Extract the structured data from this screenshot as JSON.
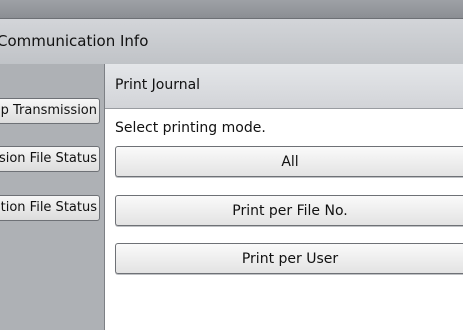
{
  "screen": {
    "title": "Communication Info",
    "left_buttons": [
      {
        "label": "Stop Transmission"
      },
      {
        "label": "Transmission File Status"
      },
      {
        "label": "Reception File Status"
      }
    ]
  },
  "dialog": {
    "title": "Print Journal",
    "prompt": "Select printing mode.",
    "options": [
      {
        "label": "All"
      },
      {
        "label": "Print per File No."
      },
      {
        "label": "Print per User"
      }
    ]
  }
}
